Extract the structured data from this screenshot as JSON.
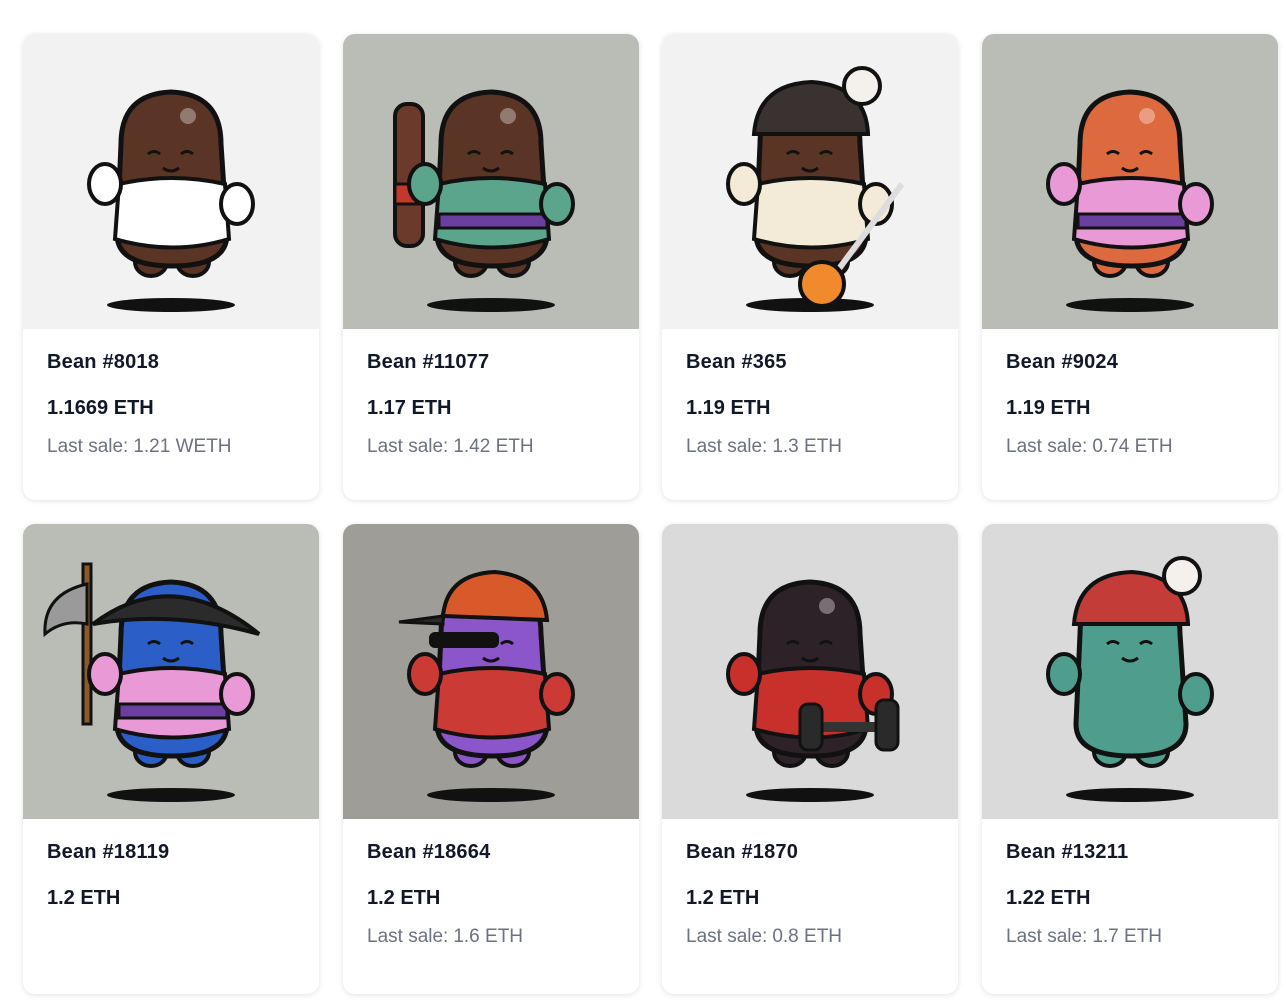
{
  "last_sale_label": "Last sale:",
  "cards": [
    {
      "name": "Bean #8018",
      "price": "1.1669 ETH",
      "last_sale": "1.21 WETH",
      "bg": "#f1f2f1",
      "body": "#5a3424",
      "accent": "#ffffff",
      "outfit": "lab-coat",
      "head": "none"
    },
    {
      "name": "Bean #11077",
      "price": "1.17 ETH",
      "last_sale": "1.42 ETH",
      "bg": "#babcb6",
      "body": "#5a3424",
      "accent": "#5aa58c",
      "outfit": "hanbok",
      "head": "none",
      "prop": "bat"
    },
    {
      "name": "Bean #365",
      "price": "1.19 ETH",
      "last_sale": "1.3 ETH",
      "bg": "#f1f2f1",
      "body": "#5a3424",
      "accent": "#f3ead7",
      "outfit": "sweater",
      "head": "beanie-dark",
      "prop": "lollipop"
    },
    {
      "name": "Bean #9024",
      "price": "1.19 ETH",
      "last_sale": "0.74 ETH",
      "bg": "#babcb6",
      "body": "#dd6a3e",
      "accent": "#e99ad6",
      "outfit": "kimono",
      "head": "none"
    },
    {
      "name": "Bean #18119",
      "price": "1.2 ETH",
      "last_sale": "",
      "bg": "#babcb6",
      "body": "#2b5fc7",
      "accent": "#e99ad6",
      "outfit": "kimono",
      "head": "hat",
      "prop": "axe"
    },
    {
      "name": "Bean #18664",
      "price": "1.2 ETH",
      "last_sale": "1.6 ETH",
      "bg": "#9e9d98",
      "body": "#8a56c9",
      "accent": "#cc3a36",
      "outfit": "varsity",
      "head": "cap"
    },
    {
      "name": "Bean #1870",
      "price": "1.2 ETH",
      "last_sale": "0.8 ETH",
      "bg": "#d9dad9",
      "body": "#2e2229",
      "accent": "#c7302b",
      "outfit": "tracksuit",
      "head": "none",
      "prop": "dumbbell"
    },
    {
      "name": "Bean #13211",
      "price": "1.22 ETH",
      "last_sale": "1.7 ETH",
      "bg": "#d9dad9",
      "body": "#4f9e8d",
      "accent": "#c33c38",
      "outfit": "none",
      "head": "beanie-red"
    }
  ]
}
